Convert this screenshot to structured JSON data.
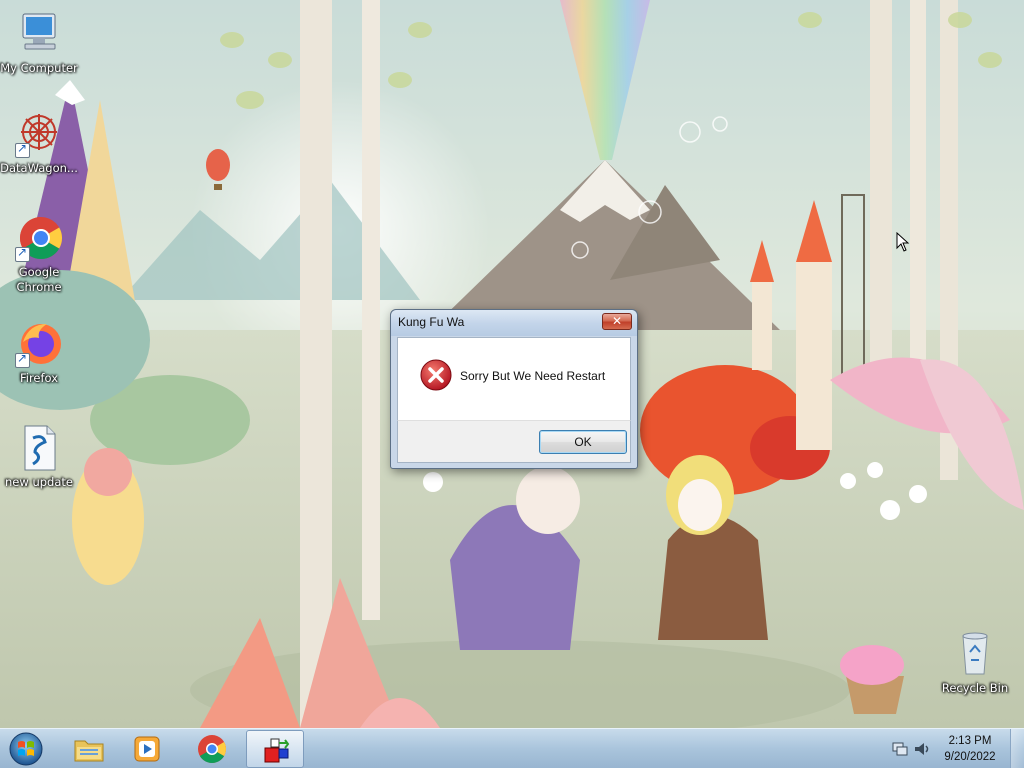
{
  "desktop": {
    "icons": [
      {
        "id": "my-computer",
        "label": "My Computer"
      },
      {
        "id": "datawagon",
        "label": "DataWagon..."
      },
      {
        "id": "google-chrome",
        "label": "Google Chrome"
      },
      {
        "id": "firefox",
        "label": "Firefox"
      },
      {
        "id": "new-update",
        "label": "new update"
      },
      {
        "id": "recycle-bin",
        "label": "Recycle Bin"
      }
    ]
  },
  "dialog": {
    "title": "Kung Fu Wa",
    "close_label": "✕",
    "message": "Sorry But We Need Restart",
    "ok_label": "OK",
    "icon": "error-icon"
  },
  "taskbar": {
    "start_icon": "windows-start-orb",
    "pinned": [
      {
        "id": "explorer",
        "icon": "folder-icon"
      },
      {
        "id": "media-player",
        "icon": "media-player-icon"
      },
      {
        "id": "chrome",
        "icon": "chrome-icon"
      },
      {
        "id": "kung-fu-wa",
        "icon": "app-cube-icon",
        "active": true
      }
    ],
    "tray": {
      "icons": [
        "network-icon",
        "volume-icon"
      ],
      "time": "2:13 PM",
      "date": "9/20/2022"
    }
  },
  "colors": {
    "taskbar": "#a8c4de",
    "dialog_frame": "#c9d7e8",
    "close_button": "#c0402a",
    "error_red": "#c8102e"
  }
}
